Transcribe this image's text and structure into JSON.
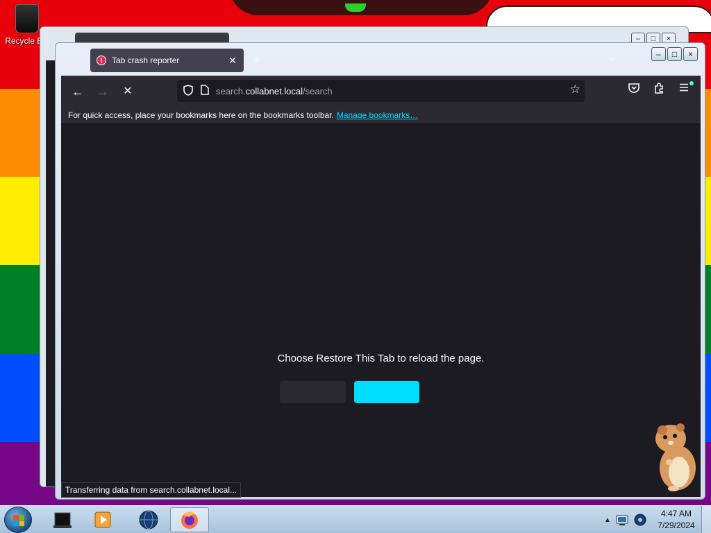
{
  "desktop": {
    "icons": [
      {
        "label": "Recycle Bin",
        "icon": "recycle-bin-icon"
      }
    ]
  },
  "browser": {
    "tab": {
      "title": "Tab crash reporter",
      "icon": "alert-icon"
    },
    "window_controls": {
      "minimize": "–",
      "maximize": "□",
      "close": "×"
    },
    "nav": {
      "back": "←",
      "forward": "→",
      "stop": "✕"
    },
    "url": {
      "prefix": "search.",
      "host": "collabnet.local",
      "path": "/search"
    },
    "bookmarks_bar": {
      "text": "For quick access, place your bookmarks here on the bookmarks toolbar.",
      "link": "Manage bookmarks…"
    },
    "content": {
      "message": "Choose Restore This Tab to reload the page.",
      "secondary_button": "",
      "primary_button": ""
    },
    "status": "Transferring data from search.collabnet.local..."
  },
  "taskbar": {
    "clock_time": "4:47 AM",
    "clock_date": "7/29/2024"
  },
  "colors": {
    "accent": "#00ddff",
    "browser_bg": "#1c1b22",
    "toolbar_bg": "#2b2a33"
  }
}
